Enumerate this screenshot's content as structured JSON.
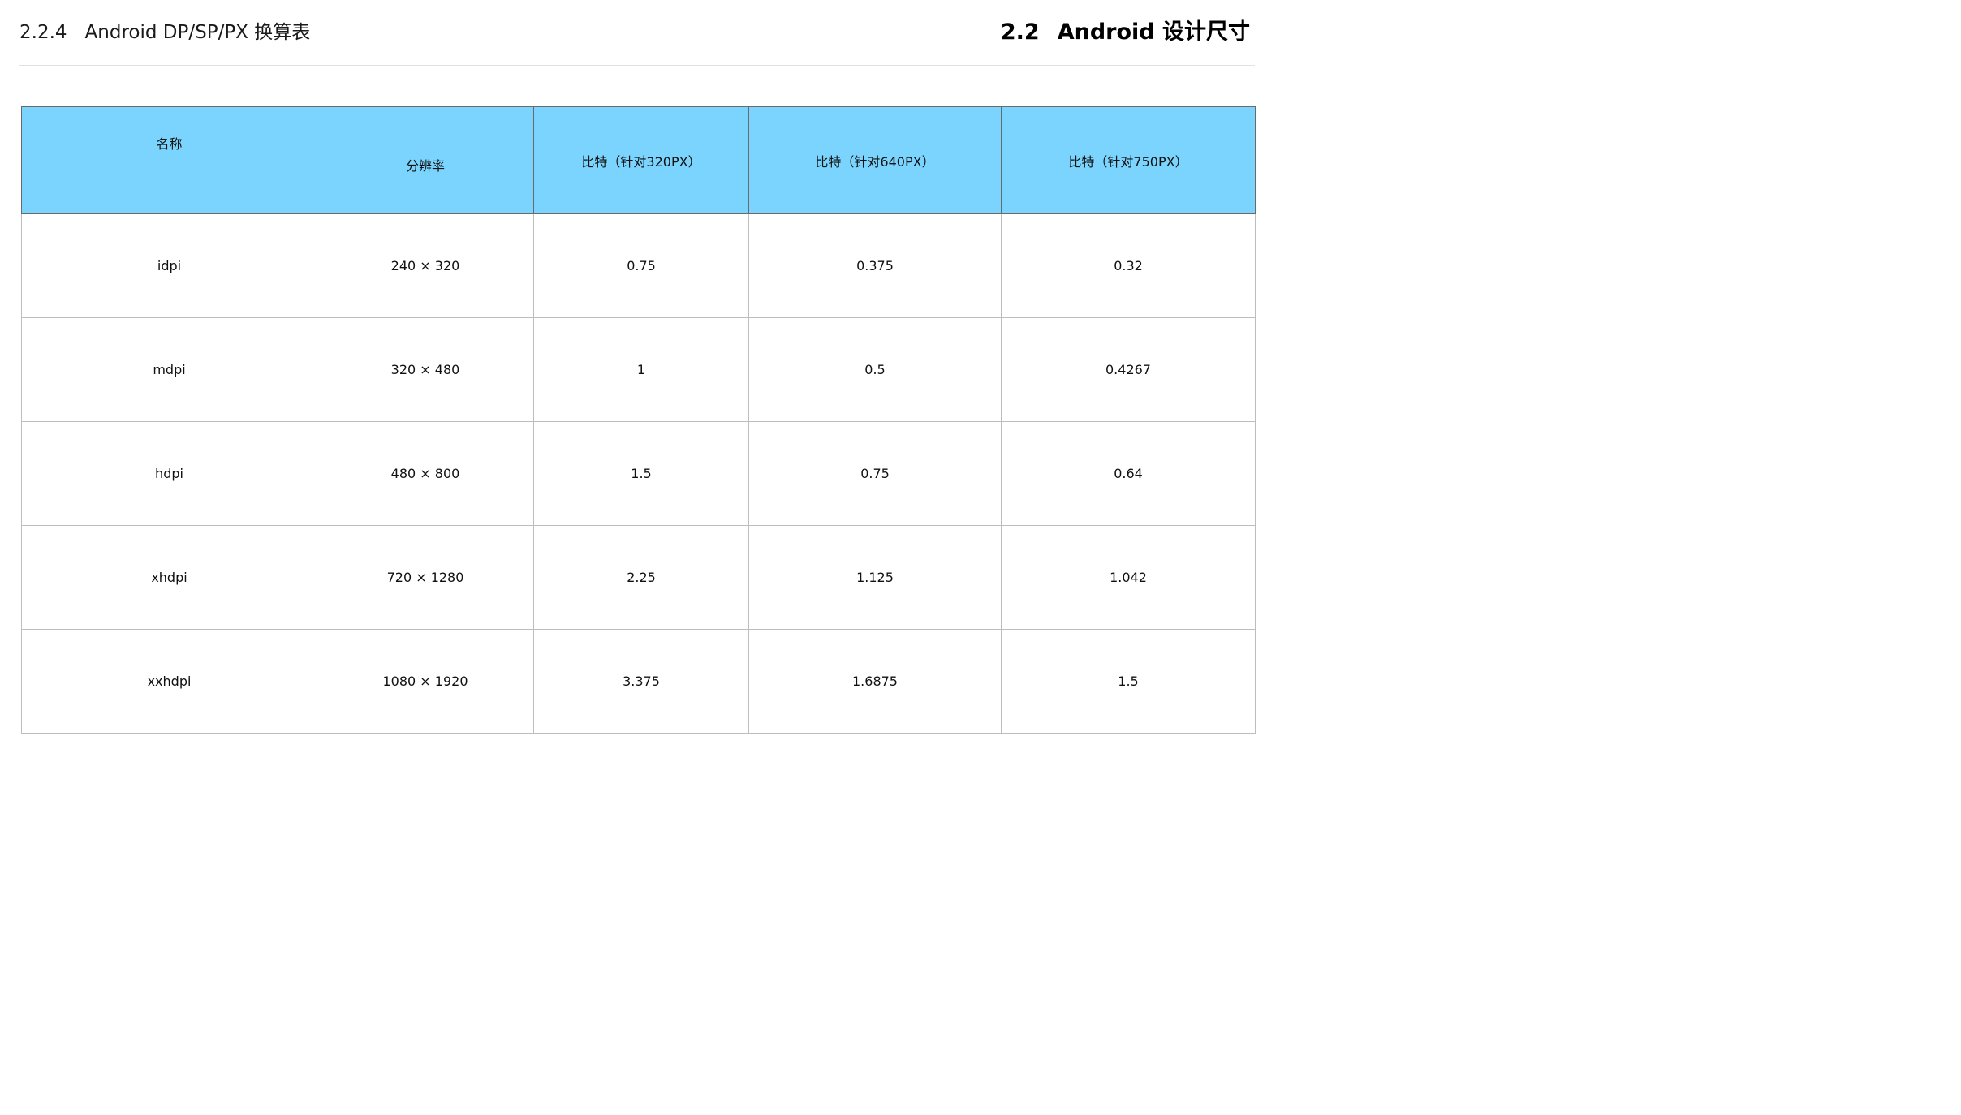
{
  "header": {
    "section_number": "2.2.4",
    "section_title": "Android DP/SP/PX 换算表",
    "chapter_number": "2.2",
    "chapter_title": "Android 设计尺寸"
  },
  "table": {
    "columns": [
      "名称",
      "分辨率",
      "比特（针对320PX）",
      "比特（针对640PX）",
      "比特（针对750PX）"
    ],
    "rows": [
      [
        "idpi",
        "240 × 320",
        "0.75",
        "0.375",
        "0.32"
      ],
      [
        "mdpi",
        "320 × 480",
        "1",
        "0.5",
        "0.4267"
      ],
      [
        "hdpi",
        "480 × 800",
        "1.5",
        "0.75",
        "0.64"
      ],
      [
        "xhdpi",
        "720 × 1280",
        "2.25",
        "1.125",
        "1.042"
      ],
      [
        "xxhdpi",
        "1080 × 1920",
        "3.375",
        "1.6875",
        "1.5"
      ]
    ]
  },
  "colors": {
    "header_fill": "#7ad4fd",
    "grid_line": "#bdbdbd",
    "text": "#111111"
  }
}
